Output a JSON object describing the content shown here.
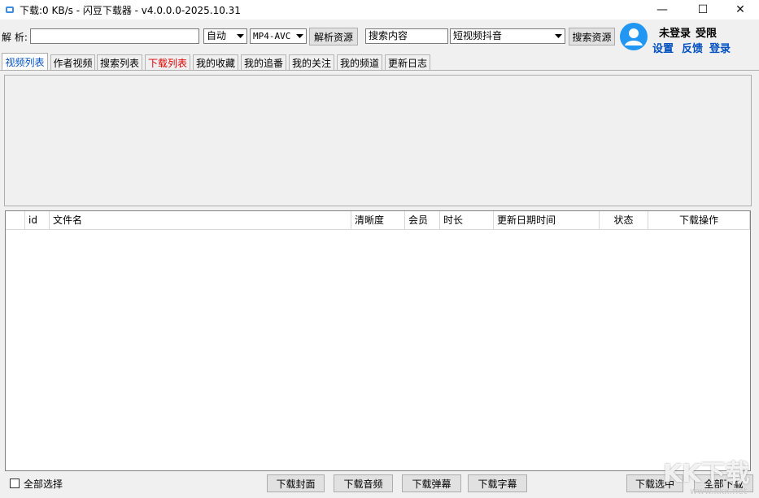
{
  "window": {
    "title": "下载:0 KB/s - 闪豆下载器 - v4.0.0.0-2025.10.31",
    "minimize": "—",
    "maximize": "☐",
    "close": "✕"
  },
  "toolbar": {
    "parse_label": "解  析:",
    "url_value": "",
    "quality_select": "自动",
    "format_select": "MP4-AVC",
    "parse_button": "解析资源",
    "search_value": "搜索内容",
    "platform_select": "短视频抖音",
    "search_button": "搜索资源"
  },
  "user": {
    "status": "未登录",
    "limit": "受限",
    "settings": "设置",
    "feedback": "反馈",
    "login": "登录"
  },
  "tabs": [
    "视频列表",
    "作者视频",
    "搜索列表",
    "下载列表",
    "我的收藏",
    "我的追番",
    "我的关注",
    "我的频道",
    "更新日志"
  ],
  "table": {
    "columns": [
      "",
      "id",
      "文件名",
      "清晰度",
      "会员",
      "时长",
      "更新日期时间",
      "状态",
      "下载操作"
    ]
  },
  "footer": {
    "select_all": "全部选择",
    "download_cover": "下载封面",
    "download_audio": "下载音频",
    "download_danmaku": "下载弹幕",
    "download_subtitle": "下载字幕",
    "download_selected": "下载选中",
    "download_all": "全部下载"
  },
  "watermark": {
    "text": "KK下载",
    "url": "www.kkx.net"
  },
  "colors": {
    "accent_blue": "#0050c0",
    "active_red": "#e00000",
    "avatar_blue": "#2196f3"
  }
}
